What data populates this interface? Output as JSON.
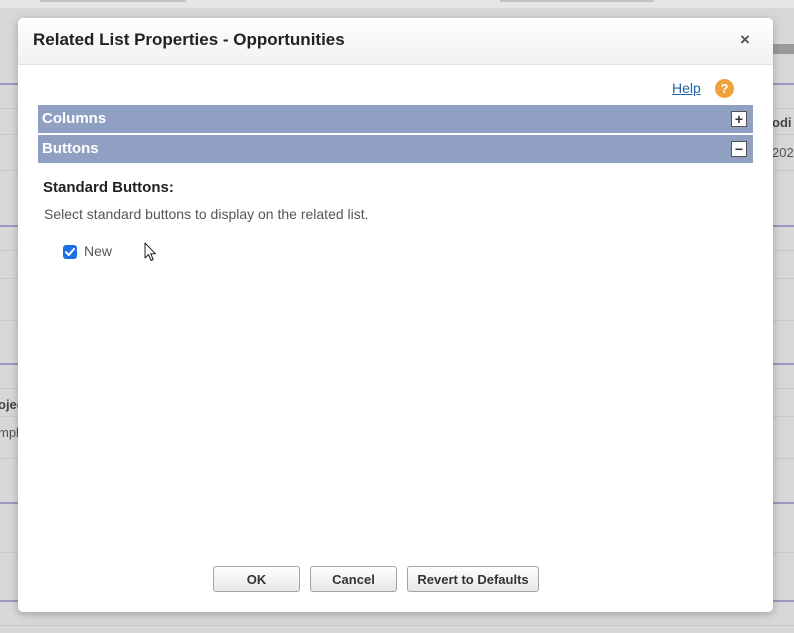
{
  "background": {
    "right_header_fragment": "odi",
    "right_value_fragment": "202",
    "left_header_fragment": "ojec",
    "left_value_fragment": "mpl"
  },
  "dialog": {
    "title": "Related List Properties - Opportunities",
    "close_glyph": "×",
    "help_label": "Help",
    "help_glyph": "?",
    "sections": [
      {
        "label": "Columns",
        "toggle": "+"
      },
      {
        "label": "Buttons",
        "toggle": "−"
      }
    ],
    "standard_buttons_heading": "Standard Buttons:",
    "standard_buttons_description": "Select standard buttons to display on the related list.",
    "buttons_options": [
      {
        "label": "New",
        "checked": true
      }
    ],
    "footer": {
      "ok_label": "OK",
      "cancel_label": "Cancel",
      "revert_label": "Revert to Defaults"
    }
  },
  "colors": {
    "section_bar": "#8fa0c3",
    "link": "#1b63a8",
    "help_icon": "#f0a23a",
    "checkbox": "#1f6fe0"
  }
}
